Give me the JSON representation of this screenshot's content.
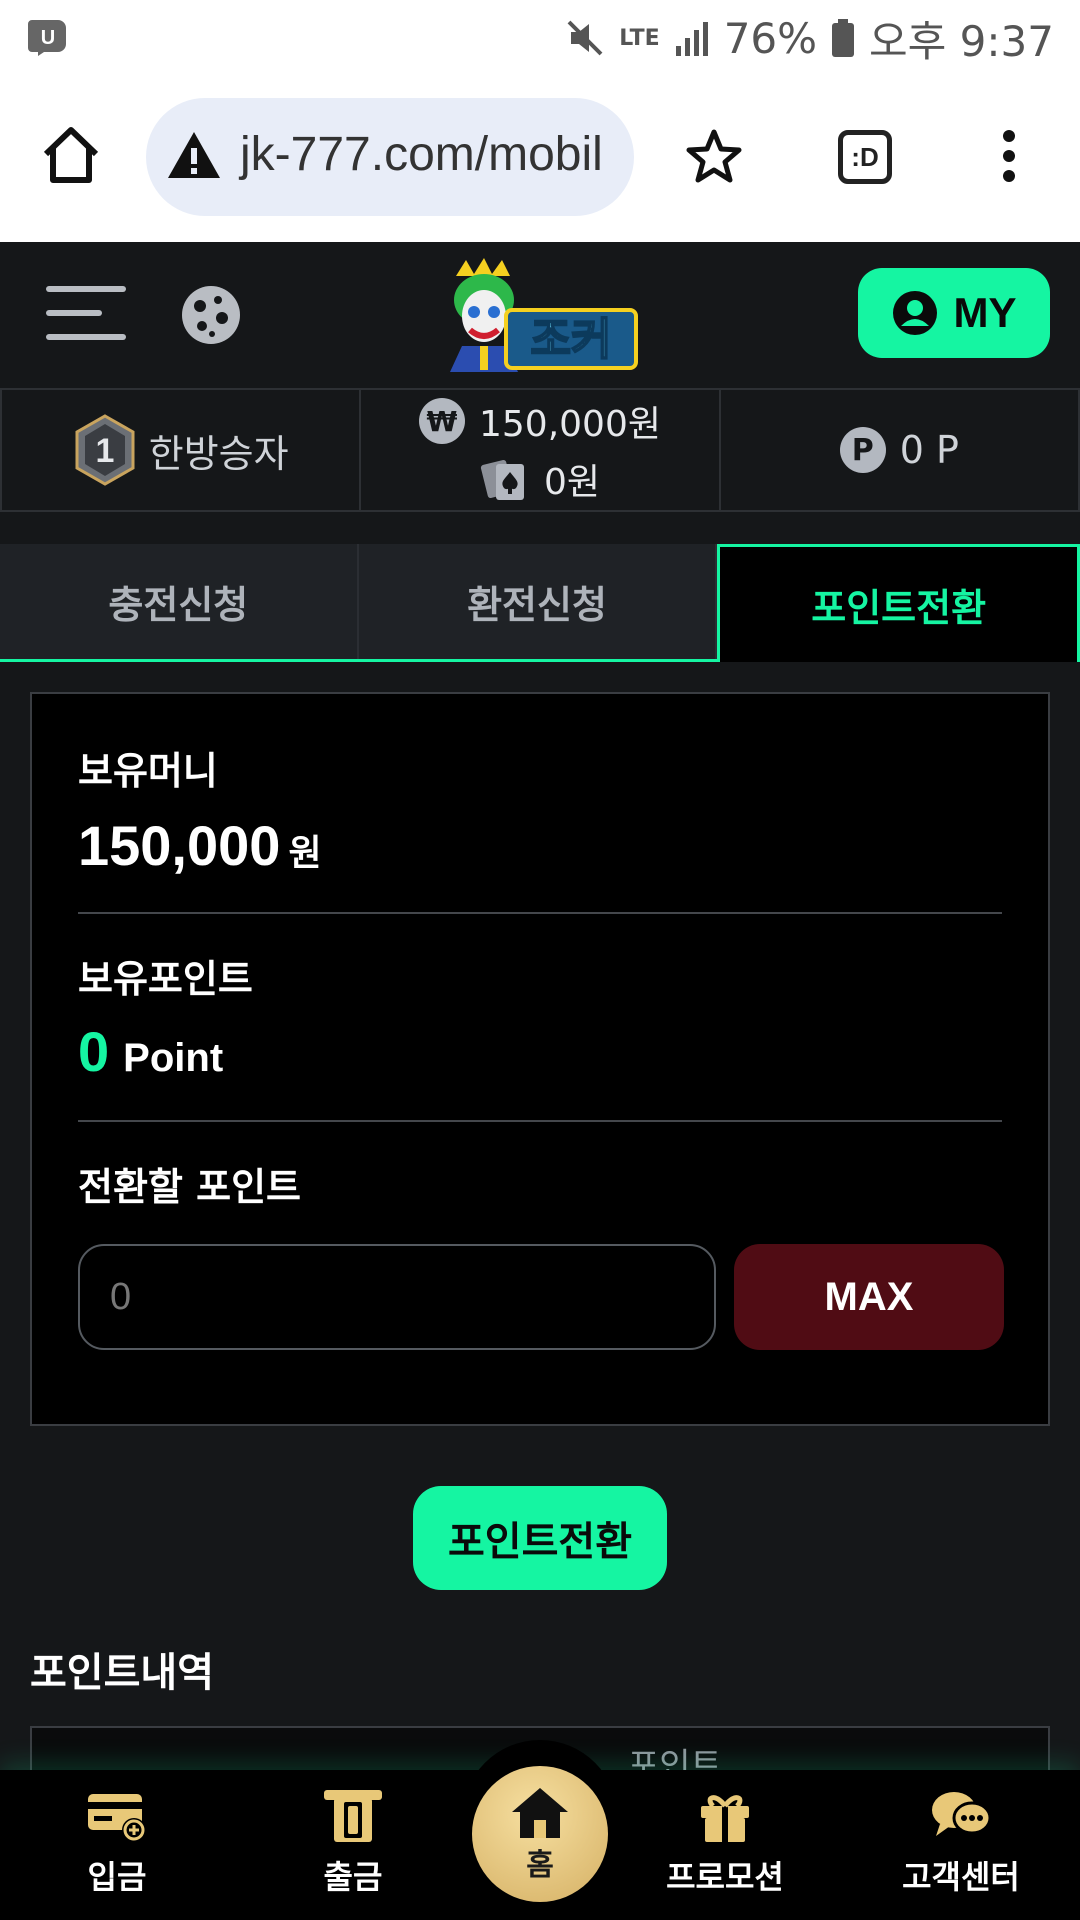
{
  "status_bar": {
    "battery": "76%",
    "time": "오후 9:37",
    "network": "LTE"
  },
  "browser": {
    "url": "jk-777.com/mobil",
    "tab_switcher": ":D"
  },
  "header": {
    "my_label": "MY",
    "accent_color": "#15f5a2"
  },
  "info": {
    "grade_level": "1",
    "grade_name": "한방승자",
    "money_symbol": "₩",
    "balance": "150,000원",
    "casino_balance": "0원",
    "point_symbol": "P",
    "points": "0 P"
  },
  "tabs": [
    {
      "label": "충전신청",
      "active": false
    },
    {
      "label": "환전신청",
      "active": false
    },
    {
      "label": "포인트전환",
      "active": true
    }
  ],
  "card": {
    "money_label": "보유머니",
    "money_value": "150,000",
    "money_unit": "원",
    "point_label": "보유포인트",
    "point_value": "0",
    "point_unit": "Point",
    "convert_label": "전환할 포인트",
    "input_placeholder": "0",
    "max_label": "MAX"
  },
  "convert_button": "포인트전환",
  "history": {
    "title": "포인트내역",
    "column_point": "포인트"
  },
  "bottom_nav": [
    {
      "label": "입금",
      "icon": "card-deposit-icon"
    },
    {
      "label": "출금",
      "icon": "withdraw-icon"
    },
    {
      "label": "홈",
      "icon": "home-icon"
    },
    {
      "label": "프로모션",
      "icon": "gift-icon"
    },
    {
      "label": "고객센터",
      "icon": "chat-icon"
    }
  ]
}
